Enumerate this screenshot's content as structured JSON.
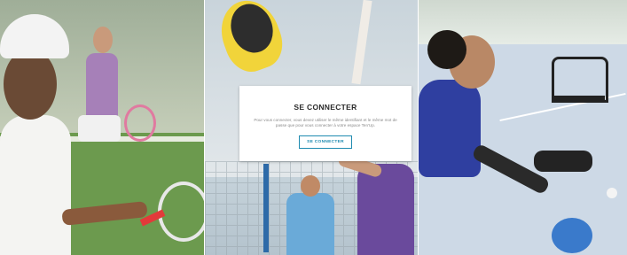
{
  "modal": {
    "title": "SE CONNECTER",
    "description": "Pour vous connecter, vous devez utiliser le même identifiant et le même mot de passe que pour vous connecter à votre espace Ten'Up.",
    "connect_button": "SE CONNECTER"
  },
  "colors": {
    "accent": "#1f8bb0",
    "modal_background": "#ffffff"
  }
}
